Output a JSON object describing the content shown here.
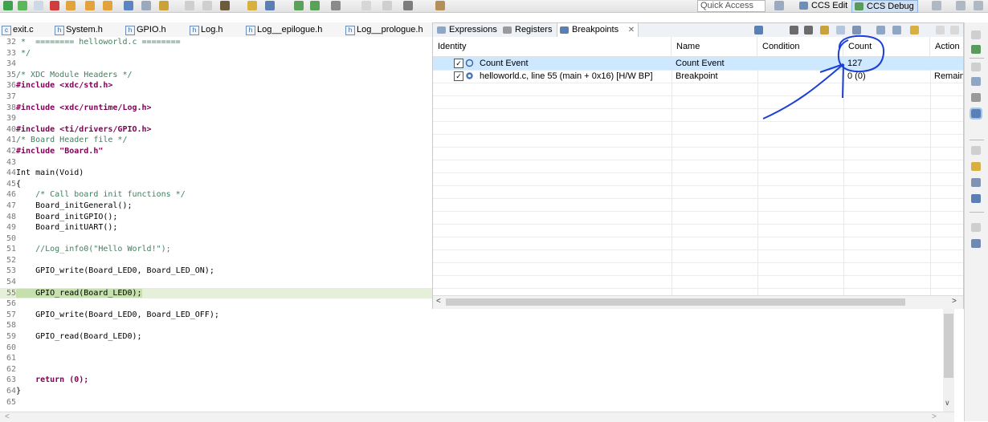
{
  "toolbar": {
    "quick_access_placeholder": "Quick Access",
    "perspective_edit": "CCS Edit",
    "perspective_debug": "CCS Debug"
  },
  "editor": {
    "tabs": [
      "exit.c",
      "System.h",
      "GPIO.h",
      "Log.h",
      "Log__epilogue.h",
      "Log__prologue.h"
    ],
    "lines": [
      {
        "n": "32",
        "t": " *  ======== helloworld.c ========"
      },
      {
        "n": "33",
        "t": " */"
      },
      {
        "n": "34",
        "t": ""
      },
      {
        "n": "35",
        "t": "/* XDC Module Headers */"
      },
      {
        "n": "36",
        "t": "#include <xdc/std.h>"
      },
      {
        "n": "37",
        "t": ""
      },
      {
        "n": "38",
        "t": "#include <xdc/runtime/Log.h>"
      },
      {
        "n": "39",
        "t": ""
      },
      {
        "n": "40",
        "t": "#include <ti/drivers/GPIO.h>"
      },
      {
        "n": "41",
        "t": "/* Board Header file */"
      },
      {
        "n": "42",
        "t": "#include \"Board.h\""
      },
      {
        "n": "43",
        "t": ""
      },
      {
        "n": "44",
        "t": "Int main(Void)"
      },
      {
        "n": "45",
        "t": "{"
      },
      {
        "n": "46",
        "t": "    /* Call board init functions */"
      },
      {
        "n": "47",
        "t": "    Board_initGeneral();"
      },
      {
        "n": "48",
        "t": "    Board_initGPIO();"
      },
      {
        "n": "49",
        "t": "    Board_initUART();"
      },
      {
        "n": "50",
        "t": ""
      },
      {
        "n": "51",
        "t": "    //Log_info0(\"Hello World!\");"
      },
      {
        "n": "52",
        "t": ""
      },
      {
        "n": "53",
        "t": "    GPIO_write(Board_LED0, Board_LED_ON);"
      },
      {
        "n": "54",
        "t": ""
      },
      {
        "n": "55",
        "t": "    GPIO_read(Board_LED0);"
      },
      {
        "n": "56",
        "t": ""
      },
      {
        "n": "57",
        "t": "    GPIO_write(Board_LED0, Board_LED_OFF);"
      },
      {
        "n": "58",
        "t": ""
      },
      {
        "n": "59",
        "t": "    GPIO_read(Board_LED0);"
      },
      {
        "n": "60",
        "t": ""
      },
      {
        "n": "61",
        "t": ""
      },
      {
        "n": "62",
        "t": ""
      },
      {
        "n": "63",
        "t": "    return (0);"
      },
      {
        "n": "64",
        "t": "}"
      },
      {
        "n": "65",
        "t": ""
      }
    ],
    "current_line": "55"
  },
  "breakpoints_view": {
    "tabs": [
      "Expressions",
      "Registers",
      "Breakpoints"
    ],
    "columns": [
      "Identity",
      "Name",
      "Condition",
      "Count",
      "Action"
    ],
    "rows": [
      {
        "identity": "Count Event",
        "name": "Count Event",
        "condition": "",
        "count": "127",
        "action": "",
        "checked": true
      },
      {
        "identity": "helloworld.c, line 55 (main + 0x16)  [H/W BP]",
        "name": "Breakpoint",
        "condition": "",
        "count": "0 (0)",
        "action": "Remain",
        "checked": true
      }
    ]
  },
  "colors": {
    "annotation": "#1c3fd6",
    "selection": "#cde8ff",
    "current_line": "#c6dfae"
  },
  "icons": [
    "run-icon",
    "suspend-icon",
    "terminate-icon",
    "step-into-icon",
    "step-over-icon",
    "step-return-icon",
    "breakpoint-icon",
    "expressions-icon",
    "registers-icon",
    "breakpoints-icon",
    "remove-icon",
    "remove-all-icon",
    "collapse-icon",
    "expand-icon",
    "link-icon",
    "open-perspective-icon"
  ]
}
